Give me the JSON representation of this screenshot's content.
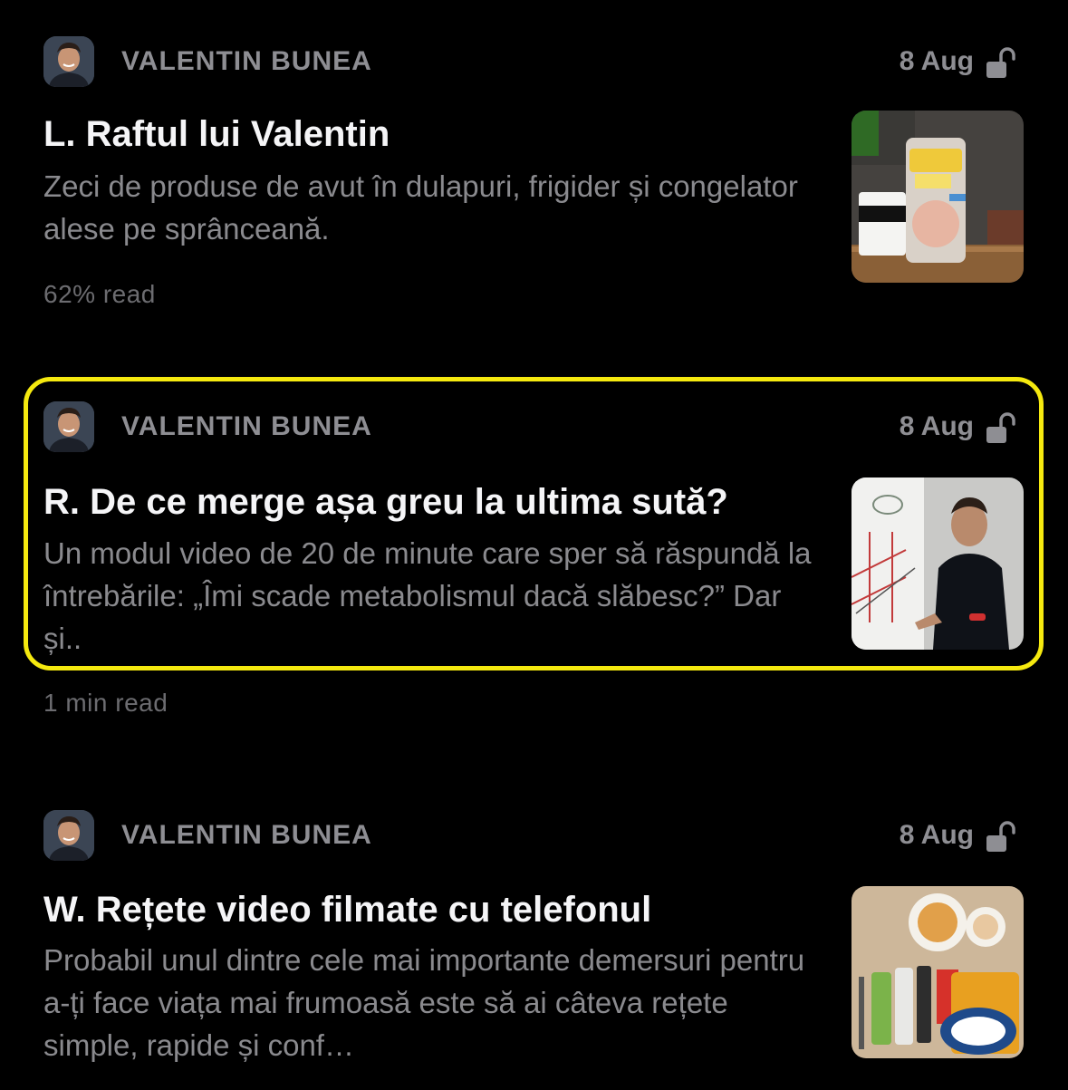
{
  "posts": [
    {
      "author": "VALENTIN BUNEA",
      "date": "8 Aug",
      "title": "L. Raftul lui Valentin",
      "subtitle": "Zeci de produse de avut în dulapuri, frigider și congelator alese pe sprânceană.",
      "meta": "62% read",
      "thumbnail": "grocery-products-thumbnail",
      "lock": "unlocked-lock-icon"
    },
    {
      "author": "VALENTIN BUNEA",
      "date": "8 Aug",
      "title": "R. De ce merge așa greu la ultima sută?",
      "subtitle": "Un modul video de 20 de minute care sper să răspundă la întrebările: „Îmi scade metabolismul dacă slăbesc?” Dar și..",
      "meta": "1 min read",
      "thumbnail": "whiteboard-presenter-thumbnail",
      "lock": "unlocked-lock-icon",
      "highlighted": true,
      "highlight_color": "#f5e90f"
    },
    {
      "author": "VALENTIN BUNEA",
      "date": "8 Aug",
      "title": "W. Rețete video filmate cu telefonul",
      "subtitle": "Probabil unul dintre cele mai importante demersuri pentru a-ți face viața mai frumoasă este să ai câteva rețete simple, rapide și conf…",
      "thumbnail": "recipe-ingredients-thumbnail",
      "lock": "unlocked-lock-icon"
    }
  ],
  "colors": {
    "background": "#000000",
    "title": "#f5f5f7",
    "secondary": "#8e8e93",
    "meta": "#6c6c70"
  }
}
